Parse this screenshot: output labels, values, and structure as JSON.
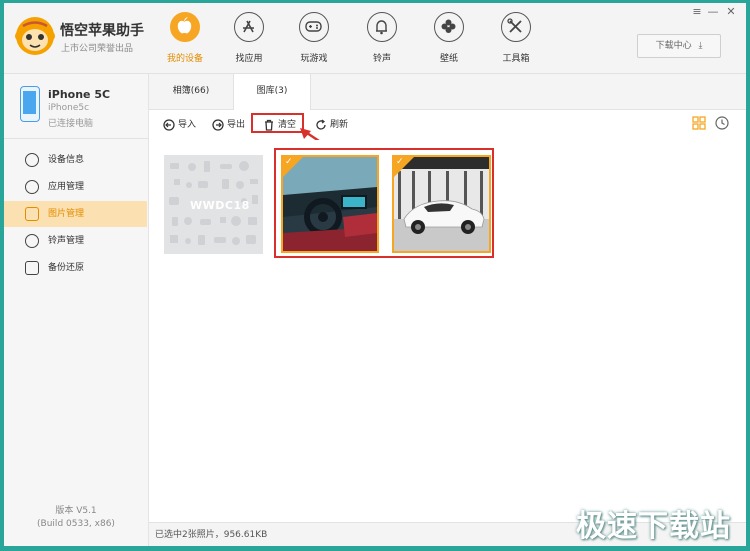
{
  "app": {
    "title": "悟空苹果助手",
    "subtitle": "上市公司荣誉出品"
  },
  "nav": [
    {
      "label": "我的设备",
      "icon": "apple-icon",
      "active": true
    },
    {
      "label": "找应用",
      "icon": "app-store-icon",
      "active": false
    },
    {
      "label": "玩游戏",
      "icon": "gamepad-icon",
      "active": false
    },
    {
      "label": "铃声",
      "icon": "bell-icon",
      "active": false
    },
    {
      "label": "壁纸",
      "icon": "clover-icon",
      "active": false
    },
    {
      "label": "工具箱",
      "icon": "tools-icon",
      "active": false
    }
  ],
  "window_buttons": {
    "menu": "≡",
    "minimize": "—",
    "close": "✕"
  },
  "download_center": {
    "label": "下载中心"
  },
  "device": {
    "name": "iPhone 5C",
    "model": "iPhone5c",
    "status": "已连接电脑"
  },
  "sidebar": {
    "items": [
      {
        "label": "设备信息",
        "icon": "info-icon",
        "active": false
      },
      {
        "label": "应用管理",
        "icon": "app-icon",
        "active": false
      },
      {
        "label": "图片管理",
        "icon": "image-icon",
        "active": true
      },
      {
        "label": "铃声管理",
        "icon": "bell-icon",
        "active": false
      },
      {
        "label": "备份还原",
        "icon": "backup-icon",
        "active": false
      }
    ],
    "version": "版本 V5.1",
    "build": "(Build 0533, x86)"
  },
  "tabs": [
    {
      "label": "相簿(66)",
      "active": false
    },
    {
      "label": "图库(3)",
      "active": true
    }
  ],
  "toolbar": {
    "import": "导入",
    "export": "导出",
    "clear": "清空",
    "refresh": "刷新"
  },
  "photos": [
    {
      "name": "wwdc-wallpaper",
      "caption": "WWDC18",
      "selected": false
    },
    {
      "name": "car-interior",
      "selected": true
    },
    {
      "name": "white-sports-car",
      "selected": true
    }
  ],
  "status": "已选中2张照片，956.61KB",
  "watermark": "极速下载站",
  "colors": {
    "accent": "#f6a623",
    "highlight": "#d9302c",
    "frame": "#2aa59a"
  }
}
